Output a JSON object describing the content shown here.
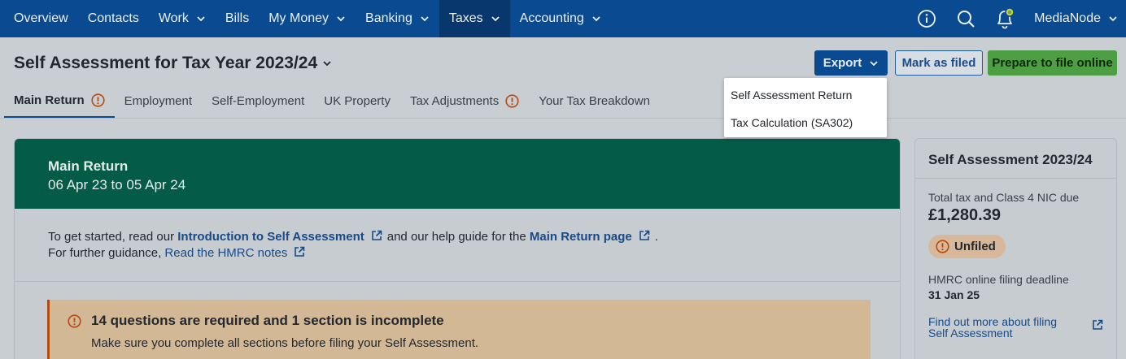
{
  "nav": {
    "items": [
      {
        "label": "Overview",
        "chevron": false,
        "active": false
      },
      {
        "label": "Contacts",
        "chevron": false,
        "active": false
      },
      {
        "label": "Work",
        "chevron": true,
        "active": false
      },
      {
        "label": "Bills",
        "chevron": false,
        "active": false
      },
      {
        "label": "My Money",
        "chevron": true,
        "active": false
      },
      {
        "label": "Banking",
        "chevron": true,
        "active": false
      },
      {
        "label": "Taxes",
        "chevron": true,
        "active": true
      },
      {
        "label": "Accounting",
        "chevron": true,
        "active": false
      }
    ],
    "org_name": "MediaNode",
    "icons": [
      "info-icon",
      "search-icon",
      "bell-icon"
    ]
  },
  "header": {
    "title": "Self Assessment for Tax Year 2023/24",
    "export_label": "Export",
    "mark_filed_label": "Mark as filed",
    "prepare_label": "Prepare to file online"
  },
  "export_menu": {
    "items": [
      "Self Assessment Return",
      "Tax Calculation (SA302)"
    ]
  },
  "tabs": [
    {
      "label": "Main Return",
      "warning": true,
      "active": true
    },
    {
      "label": "Employment",
      "warning": false,
      "active": false
    },
    {
      "label": "Self-Employment",
      "warning": false,
      "active": false
    },
    {
      "label": "UK Property",
      "warning": false,
      "active": false
    },
    {
      "label": "Tax Adjustments",
      "warning": true,
      "active": false
    },
    {
      "label": "Your Tax Breakdown",
      "warning": false,
      "active": false
    }
  ],
  "main": {
    "banner_title": "Main Return",
    "banner_dates": "06 Apr 23 to 05 Apr 24",
    "intro": {
      "prefix": "To get started, read our",
      "link1": "Introduction to Self Assessment",
      "middle": "and our help guide for the",
      "link2": "Main Return page",
      "suffix": ".",
      "line2_prefix": "For further guidance,",
      "link3": "Read the HMRC notes"
    },
    "alert": {
      "title": "14 questions are required and 1 section is incomplete",
      "body": "Make sure you complete all sections before filing your Self Assessment."
    }
  },
  "side": {
    "title": "Self Assessment 2023/24",
    "due_label": "Total tax and Class 4 NIC due",
    "due_amount": "£1,280.39",
    "status": "Unfiled",
    "deadline_label": "HMRC online filing deadline",
    "deadline": "31 Jan 25",
    "link": "Find out more about filing Self Assessment"
  },
  "colors": {
    "nav_bg": "#0a4a91",
    "banner_bg": "#045c47",
    "primary_green": "#4e9e44",
    "warning": "#b54a10",
    "link": "#174a86"
  }
}
